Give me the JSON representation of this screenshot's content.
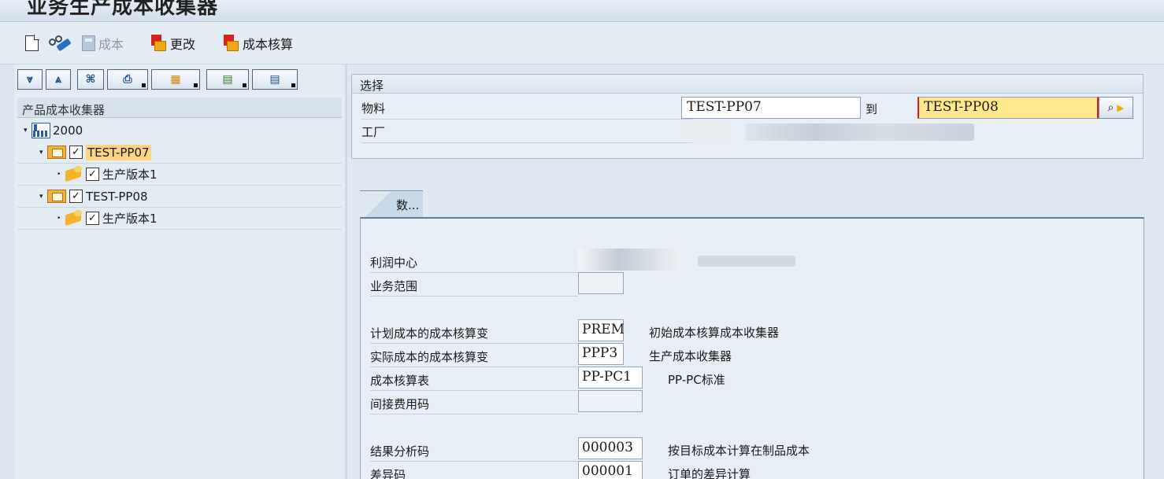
{
  "window": {
    "title": "业务生产成本收集器"
  },
  "app_toolbar": {
    "cost_label": "成本",
    "change_label": "更改",
    "costing_label": "成本核算"
  },
  "tree": {
    "header": "产品成本收集器",
    "nodes": [
      {
        "label": "2000"
      },
      {
        "label": "TEST-PP07"
      },
      {
        "label": "生产版本1"
      },
      {
        "label": "TEST-PP08"
      },
      {
        "label": "生产版本1"
      }
    ]
  },
  "selection": {
    "header": "选择",
    "material_label": "物料",
    "material_from": "TEST-PP07",
    "to_label": "到",
    "material_to": "TEST-PP08",
    "plant_label": "工厂"
  },
  "tab": {
    "label": "数..."
  },
  "details": {
    "profit_center_label": "利润中心",
    "business_area_label": "业务范围",
    "planned_variant_label": "计划成本的成本核算变",
    "planned_variant_value": "PREM",
    "planned_variant_desc": "初始成本核算成本收集器",
    "actual_variant_label": "实际成本的成本核算变",
    "actual_variant_value": "PPP3",
    "actual_variant_desc": "生产成本收集器",
    "costing_sheet_label": "成本核算表",
    "costing_sheet_value": "PP-PC1",
    "costing_sheet_desc": "PP-PC标准",
    "overhead_key_label": "间接费用码",
    "ra_key_label": "结果分析码",
    "ra_key_value": "000003",
    "ra_key_desc": "按目标成本计算在制品成本",
    "variance_key_label": "差异码",
    "variance_key_value": "000001",
    "variance_key_desc": "订单的差异计算"
  }
}
